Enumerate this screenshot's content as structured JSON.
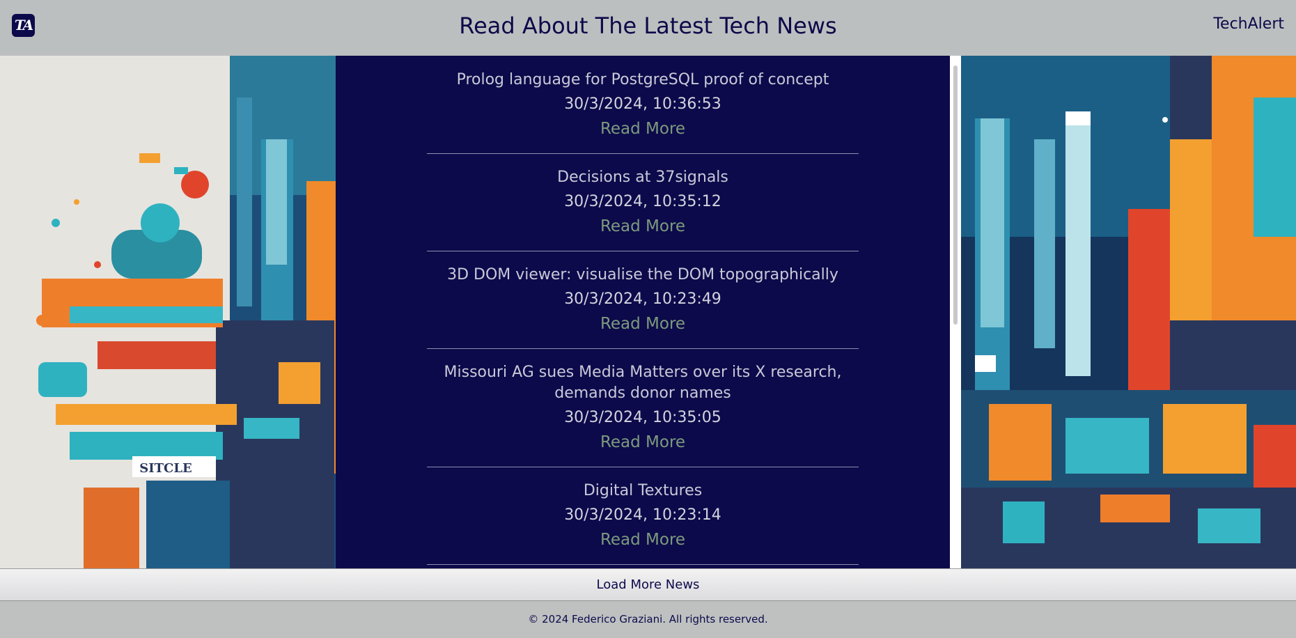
{
  "header": {
    "logo_text": "TA",
    "title": "Read About The Latest Tech News",
    "brand": "TechAlert"
  },
  "news": [
    {
      "title": "Prolog language for PostgreSQL proof of concept",
      "date": "30/3/2024, 10:36:53",
      "link_label": "Read More"
    },
    {
      "title": "Decisions at 37signals",
      "date": "30/3/2024, 10:35:12",
      "link_label": "Read More"
    },
    {
      "title": "3D DOM viewer: visualise the DOM topographically",
      "date": "30/3/2024, 10:23:49",
      "link_label": "Read More"
    },
    {
      "title": "Missouri AG sues Media Matters over its X research, demands donor names",
      "date": "30/3/2024, 10:35:05",
      "link_label": "Read More"
    },
    {
      "title": "Digital Textures",
      "date": "30/3/2024, 10:23:14",
      "link_label": "Read More"
    }
  ],
  "side_art": {
    "left_sign_text": "SITCLE"
  },
  "load_more_label": "Load More News",
  "footer": {
    "copyright": "© 2024 Federico Graziani. All rights reserved."
  },
  "colors": {
    "navy": "#0c0a4a",
    "header_bg": "#bcbfbf",
    "link_green": "#7d9a7e",
    "art_orange": "#f08a2a",
    "art_teal": "#2fb2c0",
    "art_deep": "#153a63"
  }
}
